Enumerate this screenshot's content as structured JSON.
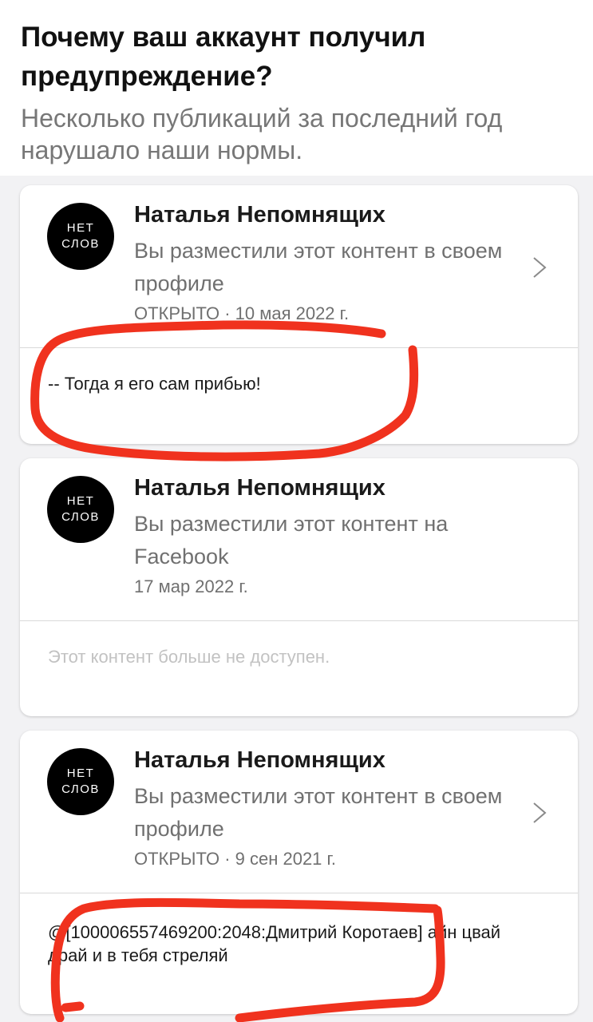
{
  "header": {
    "title": "Почему ваш аккаунт получил предупреждение?",
    "subtitle": "Несколько публикаций за последний год нарушало наши нормы."
  },
  "posts": [
    {
      "avatar_line1": "НЕТ",
      "avatar_line2": "СЛОВ",
      "author": "Наталья Непомнящих",
      "description": "Вы разместили этот контент в своем профиле",
      "date": "ОТКРЫТО · 10 мая 2022 г.",
      "text": "-- Тогда я его сам прибью!",
      "has_chevron": true
    },
    {
      "avatar_line1": "НЕТ",
      "avatar_line2": "СЛОВ",
      "author": "Наталья Непомнящих",
      "description": "Вы разместили этот контент на Facebook",
      "date": "17 мар 2022 г.",
      "text": "Этот контент больше не доступен.",
      "has_chevron": false
    },
    {
      "avatar_line1": "НЕТ",
      "avatar_line2": "СЛОВ",
      "author": "Наталья Непомнящих",
      "description": "Вы разместили этот контент в своем профиле",
      "date": "ОТКРЫТО · 9 сен 2021 г.",
      "text": "@[100006557469200:2048:Дмитрий Коротаев] айн цвай драй и в тебя стреляй",
      "has_chevron": true
    }
  ],
  "annotation_color": "#f0321e",
  "icons": {
    "chevron": "chevron-right-icon",
    "annotation": "red-marker-circle"
  }
}
